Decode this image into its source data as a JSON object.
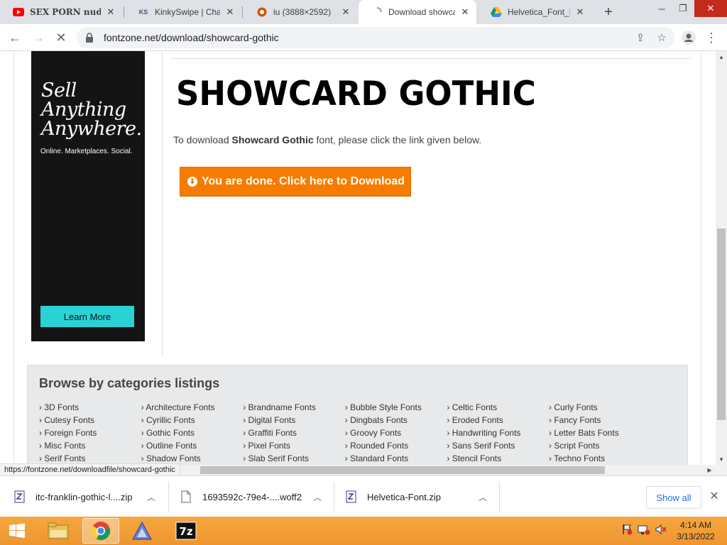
{
  "tabs": [
    {
      "title": "SEX PORN nude",
      "icon": "youtube-icon",
      "active": false
    },
    {
      "title": "KinkySwipe | Chat",
      "icon": "ks-icon",
      "active": false
    },
    {
      "title": "iu (3888×2592)",
      "icon": "image-site-icon",
      "active": false
    },
    {
      "title": "Download showca",
      "icon": "loading-spinner-icon",
      "active": true
    },
    {
      "title": "Helvetica_Font_Fan",
      "icon": "google-drive-icon",
      "active": false
    }
  ],
  "address": {
    "url": "fontzone.net/download/showcard-gothic"
  },
  "page": {
    "ad": {
      "headline_1": "Sell",
      "headline_2": "Anything",
      "headline_3": "Anywhere.",
      "subline": "Online. Marketplaces. Social.",
      "cta": "Learn More"
    },
    "font_title": "SHOWCARD GOTHIC",
    "instruction_prefix": "To download ",
    "instruction_font": "Showcard Gothic",
    "instruction_suffix": " font, please click the link given below.",
    "download_button": "You are done. Click here to Download",
    "categories": {
      "heading": "Browse by categories listings",
      "items": [
        "3D Fonts",
        "Architecture Fonts",
        "Brandname Fonts",
        "Bubble Style Fonts",
        "Celtic Fonts",
        "Curly Fonts",
        "Cutesy Fonts",
        "Cyrillic Fonts",
        "Digital Fonts",
        "Dingbats Fonts",
        "Eroded Fonts",
        "Fancy Fonts",
        "Foreign Fonts",
        "Gothic Fonts",
        "Graffiti Fonts",
        "Groovy Fonts",
        "Handwriting Fonts",
        "Letter Bats Fonts",
        "Misc Fonts",
        "Outline Fonts",
        "Pixel Fonts",
        "Rounded Fonts",
        "Sans Serif Fonts",
        "Script Fonts",
        "Serif Fonts",
        "Shadow Fonts",
        "Slab Serif Fonts",
        "Standard Fonts",
        "Stencil Fonts",
        "Techno Fonts"
      ]
    }
  },
  "status_url": "https://fontzone.net/downloadfile/showcard-gothic",
  "downloads": [
    {
      "name": "itc-franklin-gothic-l....zip",
      "icon": "zip-archive-icon"
    },
    {
      "name": "1693592c-79e4-....woff2",
      "icon": "file-icon"
    },
    {
      "name": "Helvetica-Font.zip",
      "icon": "zip-archive-icon"
    }
  ],
  "downloads_show_all": "Show all",
  "clock": {
    "time": "4:14 AM",
    "date": "3/13/2022"
  },
  "colors": {
    "download_button": "#f57c00",
    "learn_more": "#2ad2d6",
    "taskbar": "#f2a03c"
  }
}
